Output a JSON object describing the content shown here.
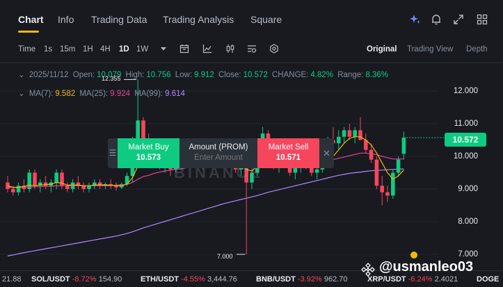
{
  "tabs": [
    {
      "label": "Chart",
      "active": true
    },
    {
      "label": "Info",
      "active": false
    },
    {
      "label": "Trading Data",
      "active": false
    },
    {
      "label": "Trading Analysis",
      "active": false
    },
    {
      "label": "Square",
      "active": false
    }
  ],
  "top_icons": [
    "ai-sparkle-icon",
    "bell-icon",
    "expand-icon",
    "grid-icon"
  ],
  "timeframes": [
    "Time",
    "1s",
    "15m",
    "1H",
    "4H",
    "1D",
    "1W"
  ],
  "active_timeframe": "1D",
  "toolbar_icons": [
    "calendar-icon",
    "line-chart-icon",
    "candles-icon",
    "screener-icon",
    "settings-hex-icon"
  ],
  "views": [
    "Original",
    "Trading View",
    "Depth"
  ],
  "active_view": "Original",
  "ohlc": {
    "date": "2025/11/12",
    "open_label": "Open:",
    "open": "10.079",
    "high_label": "High:",
    "high": "10.756",
    "low_label": "Low:",
    "low": "9.912",
    "close_label": "Close:",
    "close": "10.572",
    "change_label": "CHANGE:",
    "change": "4.82%",
    "range_label": "Range:",
    "range": "8.36%"
  },
  "ma": {
    "ma7_label": "MA(7):",
    "ma7": "9.582",
    "ma25_label": "MA(25):",
    "ma25": "9.924",
    "ma99_label": "MA(99):",
    "ma99": "9.614"
  },
  "price_axis": [
    "12.000",
    "11.000",
    "10.000",
    "9.000",
    "8.000",
    "7.000"
  ],
  "current_price": "10.572",
  "high_marker": "12.355",
  "low_marker": "7.000",
  "watermark": "BINANCE",
  "trade_panel": {
    "buy_label": "Market Buy",
    "buy_price": "10.573",
    "amount_label": "Amount (PROM)",
    "amount_placeholder": "Enter Amount",
    "sell_label": "Market Sell",
    "sell_price": "10.571"
  },
  "ticker": [
    {
      "pair": "",
      "change": "",
      "price": "21.88"
    },
    {
      "pair": "SOL/USDT",
      "change": "-8.72%",
      "price": "154.90"
    },
    {
      "pair": "ETH/USDT",
      "change": "-4.55%",
      "price": "3,444.76"
    },
    {
      "pair": "BNB/USDT",
      "change": "-3.92%",
      "price": "962.70"
    },
    {
      "pair": "XRP/USDT",
      "change": "-6.24%",
      "price": "2.4021"
    },
    {
      "pair": "DOGE",
      "change": "",
      "price": ""
    }
  ],
  "overlay_brand": "@usmanleo03",
  "colors": {
    "up": "#0ecb81",
    "down": "#f6465d",
    "ma7": "#f0b90b",
    "ma25": "#e84393",
    "ma99": "#b388ff",
    "accent": "#f0b90b"
  },
  "chart_data": {
    "type": "candlestick",
    "ylim": [
      6.8,
      12.6
    ],
    "candles": [
      [
        9.2,
        9.4,
        8.9,
        9.0
      ],
      [
        9.0,
        9.1,
        8.8,
        8.9
      ],
      [
        8.9,
        9.2,
        8.8,
        9.1
      ],
      [
        9.1,
        9.3,
        8.9,
        9.0
      ],
      [
        9.0,
        9.6,
        8.9,
        9.5
      ],
      [
        9.5,
        9.6,
        9.0,
        9.1
      ],
      [
        9.1,
        9.3,
        8.9,
        9.2
      ],
      [
        9.2,
        9.4,
        9.0,
        9.1
      ],
      [
        9.1,
        9.3,
        8.9,
        9.2
      ],
      [
        9.2,
        9.6,
        9.0,
        9.5
      ],
      [
        9.5,
        9.6,
        9.0,
        9.1
      ],
      [
        9.1,
        9.2,
        8.9,
        9.0
      ],
      [
        9.0,
        9.3,
        8.9,
        9.2
      ],
      [
        9.2,
        9.4,
        9.0,
        9.1
      ],
      [
        9.1,
        9.2,
        8.9,
        9.0
      ],
      [
        9.0,
        9.2,
        8.9,
        9.1
      ],
      [
        9.1,
        9.3,
        9.0,
        9.2
      ],
      [
        9.2,
        9.3,
        9.0,
        9.1
      ],
      [
        9.1,
        9.2,
        9.0,
        9.15
      ],
      [
        9.15,
        9.3,
        9.0,
        9.1
      ],
      [
        9.1,
        9.2,
        8.95,
        9.05
      ],
      [
        9.05,
        9.2,
        9.0,
        9.15
      ],
      [
        9.15,
        9.5,
        9.1,
        9.4
      ],
      [
        9.4,
        10.6,
        9.2,
        10.4
      ],
      [
        10.4,
        12.355,
        10.2,
        11.1
      ],
      [
        11.1,
        11.2,
        10.4,
        10.5
      ],
      [
        10.5,
        10.7,
        9.8,
        9.9
      ],
      [
        9.9,
        10.2,
        9.7,
        10.1
      ],
      [
        10.1,
        10.3,
        9.6,
        9.7
      ],
      [
        9.7,
        10.0,
        9.5,
        9.8
      ],
      [
        9.8,
        10.0,
        9.4,
        9.6
      ],
      [
        9.6,
        9.9,
        9.5,
        9.8
      ],
      [
        9.8,
        10.1,
        9.6,
        9.9
      ],
      [
        9.9,
        10.2,
        9.7,
        10.0
      ],
      [
        10.0,
        10.3,
        9.8,
        9.9
      ],
      [
        9.9,
        10.1,
        9.7,
        9.8
      ],
      [
        9.8,
        10.0,
        9.6,
        9.9
      ],
      [
        9.9,
        10.2,
        9.7,
        10.1
      ],
      [
        10.1,
        10.3,
        9.9,
        10.0
      ],
      [
        10.0,
        10.2,
        9.8,
        9.9
      ],
      [
        9.9,
        10.1,
        9.7,
        10.0
      ],
      [
        10.0,
        10.2,
        9.8,
        9.9
      ],
      [
        9.9,
        10.0,
        9.5,
        9.6
      ],
      [
        9.6,
        9.8,
        9.4,
        9.7
      ],
      [
        9.7,
        9.9,
        7.0,
        9.2
      ],
      [
        9.2,
        9.6,
        9.0,
        9.5
      ],
      [
        9.5,
        10.4,
        9.4,
        10.3
      ],
      [
        10.3,
        10.9,
        10.1,
        10.7
      ],
      [
        10.7,
        10.8,
        10.0,
        10.1
      ],
      [
        10.1,
        10.3,
        9.6,
        9.7
      ],
      [
        9.7,
        10.0,
        9.5,
        9.9
      ],
      [
        9.9,
        10.2,
        9.7,
        10.0
      ],
      [
        10.0,
        10.1,
        9.4,
        9.5
      ],
      [
        9.5,
        9.8,
        9.3,
        9.7
      ],
      [
        9.7,
        10.0,
        9.5,
        9.9
      ],
      [
        9.9,
        10.1,
        9.6,
        9.7
      ],
      [
        9.7,
        9.9,
        9.4,
        9.5
      ],
      [
        9.5,
        9.7,
        9.3,
        9.6
      ],
      [
        9.6,
        10.1,
        9.5,
        10.0
      ],
      [
        10.0,
        10.6,
        9.9,
        10.5
      ],
      [
        10.5,
        10.9,
        10.3,
        10.4
      ],
      [
        10.4,
        10.8,
        10.2,
        10.6
      ],
      [
        10.6,
        10.9,
        10.4,
        10.8
      ],
      [
        10.8,
        11.0,
        10.5,
        10.6
      ],
      [
        10.6,
        10.9,
        10.4,
        10.8
      ],
      [
        10.8,
        11.2,
        10.6,
        10.5
      ],
      [
        10.5,
        10.7,
        10.1,
        10.2
      ],
      [
        10.2,
        10.4,
        9.8,
        9.9
      ],
      [
        9.9,
        10.0,
        9.0,
        9.1
      ],
      [
        9.1,
        9.4,
        8.5,
        8.9
      ],
      [
        8.9,
        9.1,
        8.6,
        8.8
      ],
      [
        8.8,
        9.6,
        8.7,
        9.5
      ],
      [
        9.5,
        10.0,
        9.4,
        9.9
      ],
      [
        10.079,
        10.756,
        9.912,
        10.572
      ]
    ],
    "ma7": [
      9.1,
      9.05,
      9.05,
      9.08,
      9.12,
      9.1,
      9.12,
      9.13,
      9.15,
      9.2,
      9.18,
      9.12,
      9.12,
      9.12,
      9.1,
      9.1,
      9.12,
      9.13,
      9.12,
      9.12,
      9.1,
      9.1,
      9.15,
      9.35,
      9.7,
      9.95,
      10.0,
      10.05,
      10.1,
      10.05,
      9.95,
      9.8,
      9.75,
      9.8,
      9.85,
      9.85,
      9.85,
      9.9,
      9.95,
      9.95,
      9.95,
      9.95,
      9.85,
      9.8,
      9.6,
      9.55,
      9.7,
      9.95,
      10.1,
      10.1,
      10.05,
      10.0,
      9.95,
      9.85,
      9.8,
      9.8,
      9.7,
      9.65,
      9.7,
      9.85,
      10.0,
      10.2,
      10.4,
      10.55,
      10.6,
      10.6,
      10.5,
      10.35,
      10.1,
      9.8,
      9.5,
      9.3,
      9.4,
      9.58
    ],
    "ma25": [
      9.05,
      9.05,
      9.05,
      9.06,
      9.06,
      9.07,
      9.07,
      9.08,
      9.08,
      9.1,
      9.1,
      9.1,
      9.1,
      9.1,
      9.1,
      9.1,
      9.1,
      9.1,
      9.1,
      9.1,
      9.12,
      9.12,
      9.14,
      9.2,
      9.3,
      9.38,
      9.42,
      9.48,
      9.52,
      9.55,
      9.58,
      9.6,
      9.62,
      9.65,
      9.68,
      9.7,
      9.7,
      9.72,
      9.74,
      9.76,
      9.78,
      9.8,
      9.8,
      9.8,
      9.78,
      9.78,
      9.8,
      9.84,
      9.86,
      9.88,
      9.88,
      9.88,
      9.88,
      9.87,
      9.86,
      9.86,
      9.85,
      9.85,
      9.86,
      9.88,
      9.9,
      9.94,
      9.98,
      10.02,
      10.06,
      10.1,
      10.1,
      10.08,
      10.05,
      10.0,
      9.96,
      9.92,
      9.92,
      9.92
    ],
    "ma99": [
      6.95,
      6.98,
      7.02,
      7.05,
      7.08,
      7.11,
      7.14,
      7.17,
      7.2,
      7.23,
      7.26,
      7.29,
      7.32,
      7.35,
      7.38,
      7.41,
      7.44,
      7.47,
      7.5,
      7.53,
      7.56,
      7.6,
      7.64,
      7.69,
      7.75,
      7.81,
      7.86,
      7.91,
      7.96,
      8.01,
      8.06,
      8.11,
      8.16,
      8.21,
      8.26,
      8.31,
      8.36,
      8.41,
      8.46,
      8.51,
      8.56,
      8.6,
      8.64,
      8.68,
      8.72,
      8.76,
      8.8,
      8.85,
      8.9,
      8.94,
      8.98,
      9.02,
      9.06,
      9.1,
      9.14,
      9.18,
      9.22,
      9.26,
      9.3,
      9.34,
      9.38,
      9.42,
      9.45,
      9.48,
      9.5,
      9.52,
      9.54,
      9.56,
      9.57,
      9.58,
      9.59,
      9.6,
      9.61,
      9.614
    ]
  }
}
